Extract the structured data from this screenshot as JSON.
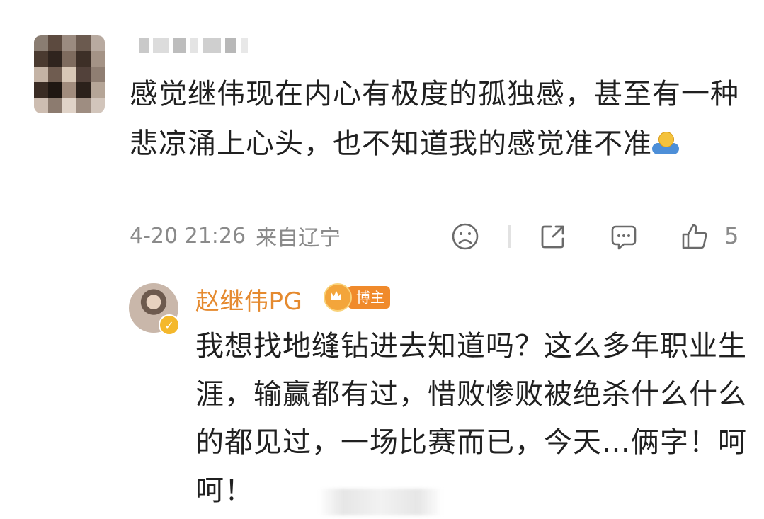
{
  "comment": {
    "username": "",
    "text": "感觉继伟现在内心有极度的孤独感，甚至有一种悲凉涌上心头，也不知道我的感觉准不准",
    "emoji_icon": "hug-emoji",
    "time": "4-20 21:26",
    "location": "来自辽宁",
    "actions": {
      "dislike_icon": "frown-face-icon",
      "share_icon": "share-icon",
      "reply_icon": "comment-bubble-icon",
      "like_icon": "thumbs-up-icon",
      "like_count": "5"
    }
  },
  "reply": {
    "username": "赵继伟PG",
    "badge_label": "博主",
    "badge_icon": "crown-icon",
    "verified_icon": "verified-v-icon",
    "text": "我想找地缝钻进去知道吗？这么多年职业生涯，输赢都有过，惜败惨败被绝杀什么什么的都见过，一场比赛而已，今天…俩字！呵呵！"
  },
  "colors": {
    "text": "#202020",
    "meta": "#8a8a8a",
    "reply_name": "#e58a2f",
    "badge": "#f08a2b"
  }
}
